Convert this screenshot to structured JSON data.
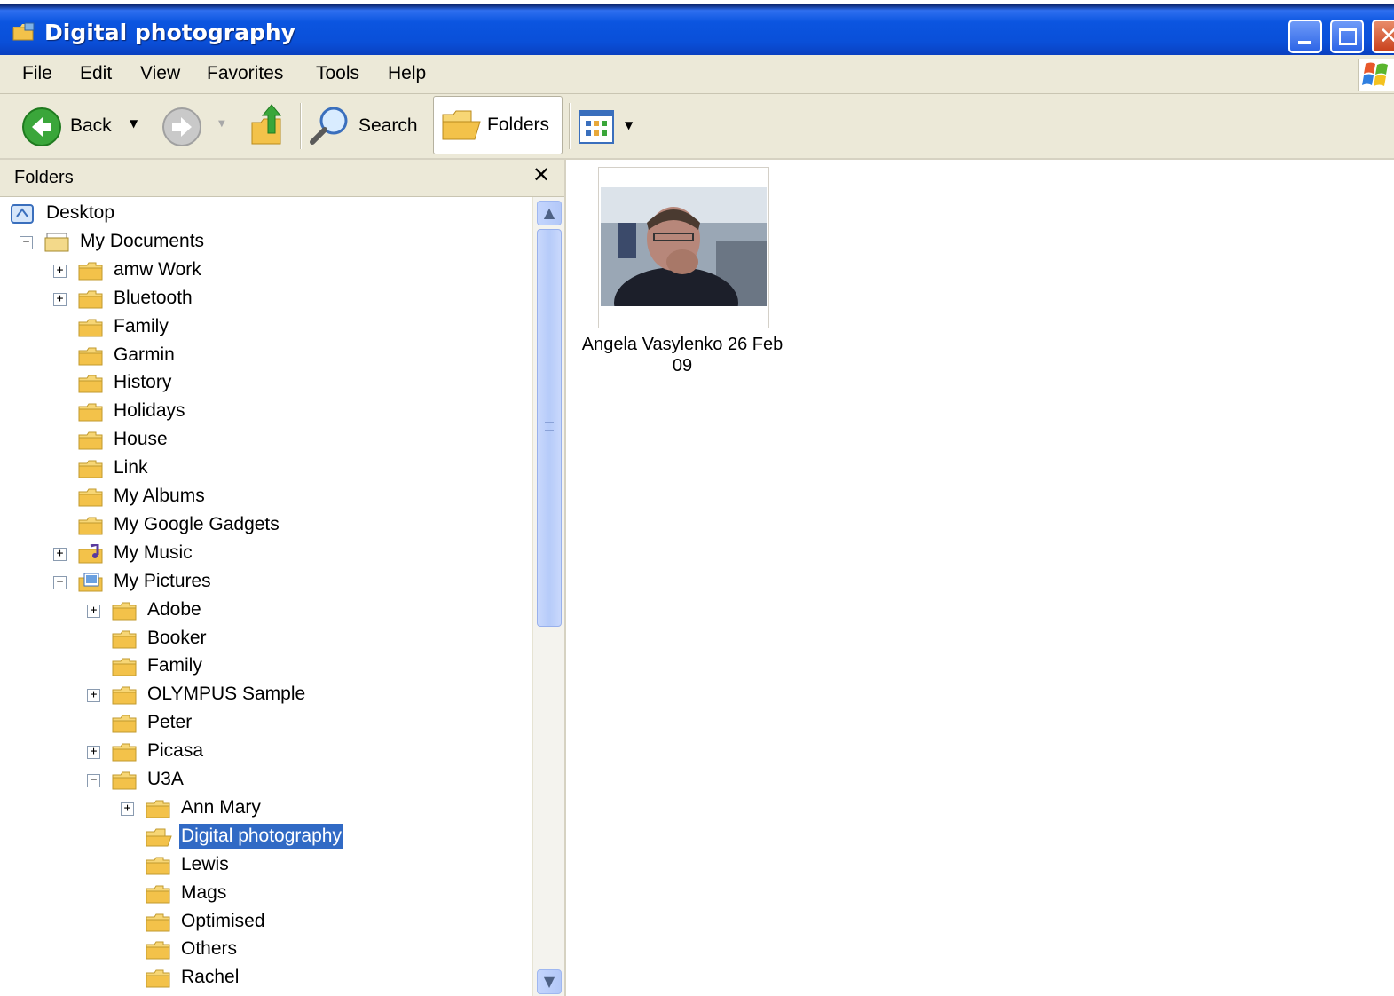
{
  "window": {
    "title": "Digital photography"
  },
  "menu": [
    "File",
    "Edit",
    "View",
    "Favorites",
    "Tools",
    "Help"
  ],
  "toolbar": {
    "back_label": "Back",
    "search_label": "Search",
    "folders_label": "Folders"
  },
  "folders_pane": {
    "title": "Folders",
    "items": [
      {
        "label": "Desktop"
      },
      {
        "label": "My Documents"
      },
      {
        "label": "amw Work"
      },
      {
        "label": "Bluetooth"
      },
      {
        "label": "Family"
      },
      {
        "label": "Garmin"
      },
      {
        "label": "History"
      },
      {
        "label": "Holidays"
      },
      {
        "label": "House"
      },
      {
        "label": "Link"
      },
      {
        "label": "My Albums"
      },
      {
        "label": "My Google Gadgets"
      },
      {
        "label": "My Music"
      },
      {
        "label": "My Pictures"
      },
      {
        "label": "Adobe"
      },
      {
        "label": "Booker"
      },
      {
        "label": "Family"
      },
      {
        "label": "OLYMPUS Sample"
      },
      {
        "label": "Peter"
      },
      {
        "label": "Picasa"
      },
      {
        "label": "U3A"
      },
      {
        "label": "Ann Mary"
      },
      {
        "label": "Digital photography"
      },
      {
        "label": "Lewis"
      },
      {
        "label": "Mags"
      },
      {
        "label": "Optimised"
      },
      {
        "label": "Others"
      },
      {
        "label": "Rachel"
      }
    ]
  },
  "content": {
    "files": [
      {
        "name": "Angela Vasylenko 26 Feb 09"
      }
    ]
  },
  "colors": {
    "titlebar": "#0b55e0",
    "selection": "#316ac5",
    "chrome": "#ece9d8"
  }
}
